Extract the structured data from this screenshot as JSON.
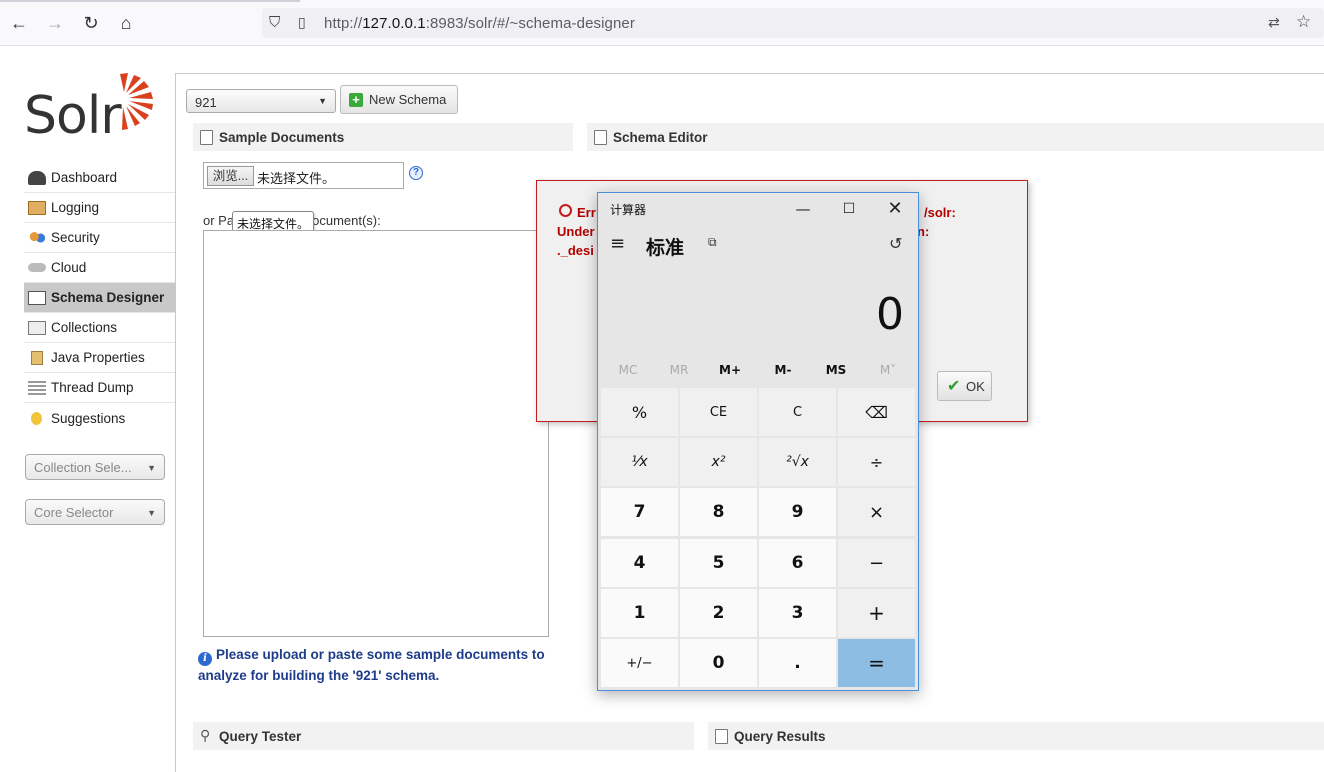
{
  "browser": {
    "url_prefix": "http://",
    "url_host": "127.0.0.1",
    "url_rest": ":8983/solr/#/~schema-designer"
  },
  "sidebar": {
    "logo_text": "Solr",
    "items": [
      {
        "label": "Dashboard",
        "icon": "dashboard-icon"
      },
      {
        "label": "Logging",
        "icon": "logging-icon"
      },
      {
        "label": "Security",
        "icon": "security-icon"
      },
      {
        "label": "Cloud",
        "icon": "cloud-icon"
      },
      {
        "label": "Schema Designer",
        "icon": "schema-icon",
        "active": true
      },
      {
        "label": "Collections",
        "icon": "collections-icon"
      },
      {
        "label": "Java Properties",
        "icon": "java-icon"
      },
      {
        "label": "Thread Dump",
        "icon": "thread-icon"
      },
      {
        "label": "Suggestions",
        "icon": "bulb-icon"
      }
    ],
    "collection_selector": "Collection Sele...",
    "core_selector": "Core Selector"
  },
  "main": {
    "schema_select": "921",
    "new_schema_label": "New Schema",
    "sample_docs_title": "Sample Documents",
    "schema_editor_title": "Schema Editor",
    "browse_label": "浏览...",
    "no_file_label": "未选择文件。",
    "help_label": "?",
    "paste_label": "or Paste Sample Document(s):",
    "tooltip": "未选择文件。",
    "info_message": "Please upload or paste some sample documents to analyze for building the '921' schema.",
    "query_tester_title": "Query Tester",
    "query_results_title": "Query Results"
  },
  "error_dialog": {
    "line1_start": "Err",
    "line1_end": "/solr:",
    "line2_start": "Under",
    "line2_end": "n:",
    "line3_start": "._desi",
    "ok_label": "OK"
  },
  "calculator": {
    "title": "计算器",
    "mode": "标准",
    "display": "0",
    "memory": [
      "MC",
      "MR",
      "M+",
      "M-",
      "MS",
      "M˅"
    ],
    "memory_disabled": [
      true,
      true,
      false,
      false,
      false,
      true
    ],
    "keys": [
      [
        "%",
        "CE",
        "C",
        "⌫"
      ],
      [
        "¹⁄x",
        "x²",
        "²√x",
        "÷"
      ],
      [
        "7",
        "8",
        "9",
        "×"
      ],
      [
        "4",
        "5",
        "6",
        "−"
      ],
      [
        "1",
        "2",
        "3",
        "+"
      ],
      [
        "+/−",
        "0",
        ".",
        "="
      ]
    ]
  }
}
